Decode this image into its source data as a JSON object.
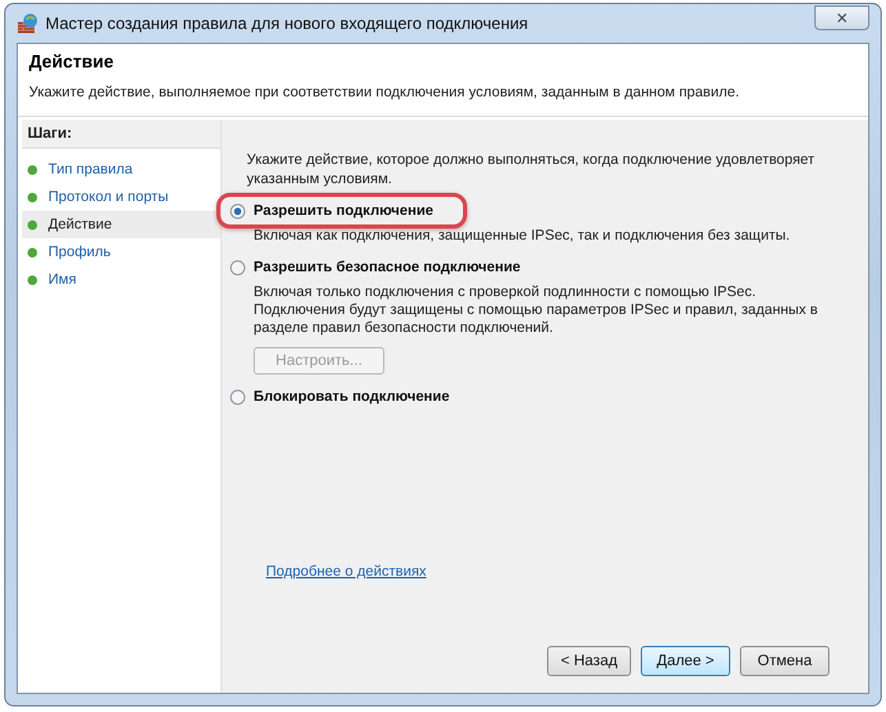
{
  "window": {
    "title": "Мастер создания правила для нового входящего подключения",
    "close_label": "✕"
  },
  "header": {
    "title": "Действие",
    "description": "Укажите действие, выполняемое при соответствии подключения условиям, заданным в данном правиле."
  },
  "sidebar": {
    "title": "Шаги:",
    "items": [
      {
        "label": "Тип правила",
        "selected": false
      },
      {
        "label": "Протокол и порты",
        "selected": false
      },
      {
        "label": "Действие",
        "selected": true
      },
      {
        "label": "Профиль",
        "selected": false
      },
      {
        "label": "Имя",
        "selected": false
      }
    ]
  },
  "content": {
    "intro": "Укажите действие, которое должно выполняться, когда подключение удовлетворяет указанным условиям.",
    "options": [
      {
        "label": "Разрешить подключение",
        "description": "Включая как подключения, защищенные IPSec, так и подключения без защиты.",
        "selected": true,
        "highlighted": true
      },
      {
        "label": "Разрешить безопасное подключение",
        "description": "Включая только подключения с проверкой подлинности с помощью IPSec. Подключения будут защищены с помощью параметров IPSec и правил, заданных в разделе правил безопасности подключений.",
        "selected": false,
        "highlighted": false,
        "button": {
          "label": "Настроить...",
          "disabled": true
        }
      },
      {
        "label": "Блокировать подключение",
        "selected": false,
        "highlighted": false
      }
    ],
    "link": "Подробнее о действиях"
  },
  "buttons": [
    {
      "label": "< Назад",
      "default": false
    },
    {
      "label": "Далее >",
      "default": true
    },
    {
      "label": "Отмена",
      "default": false
    }
  ]
}
